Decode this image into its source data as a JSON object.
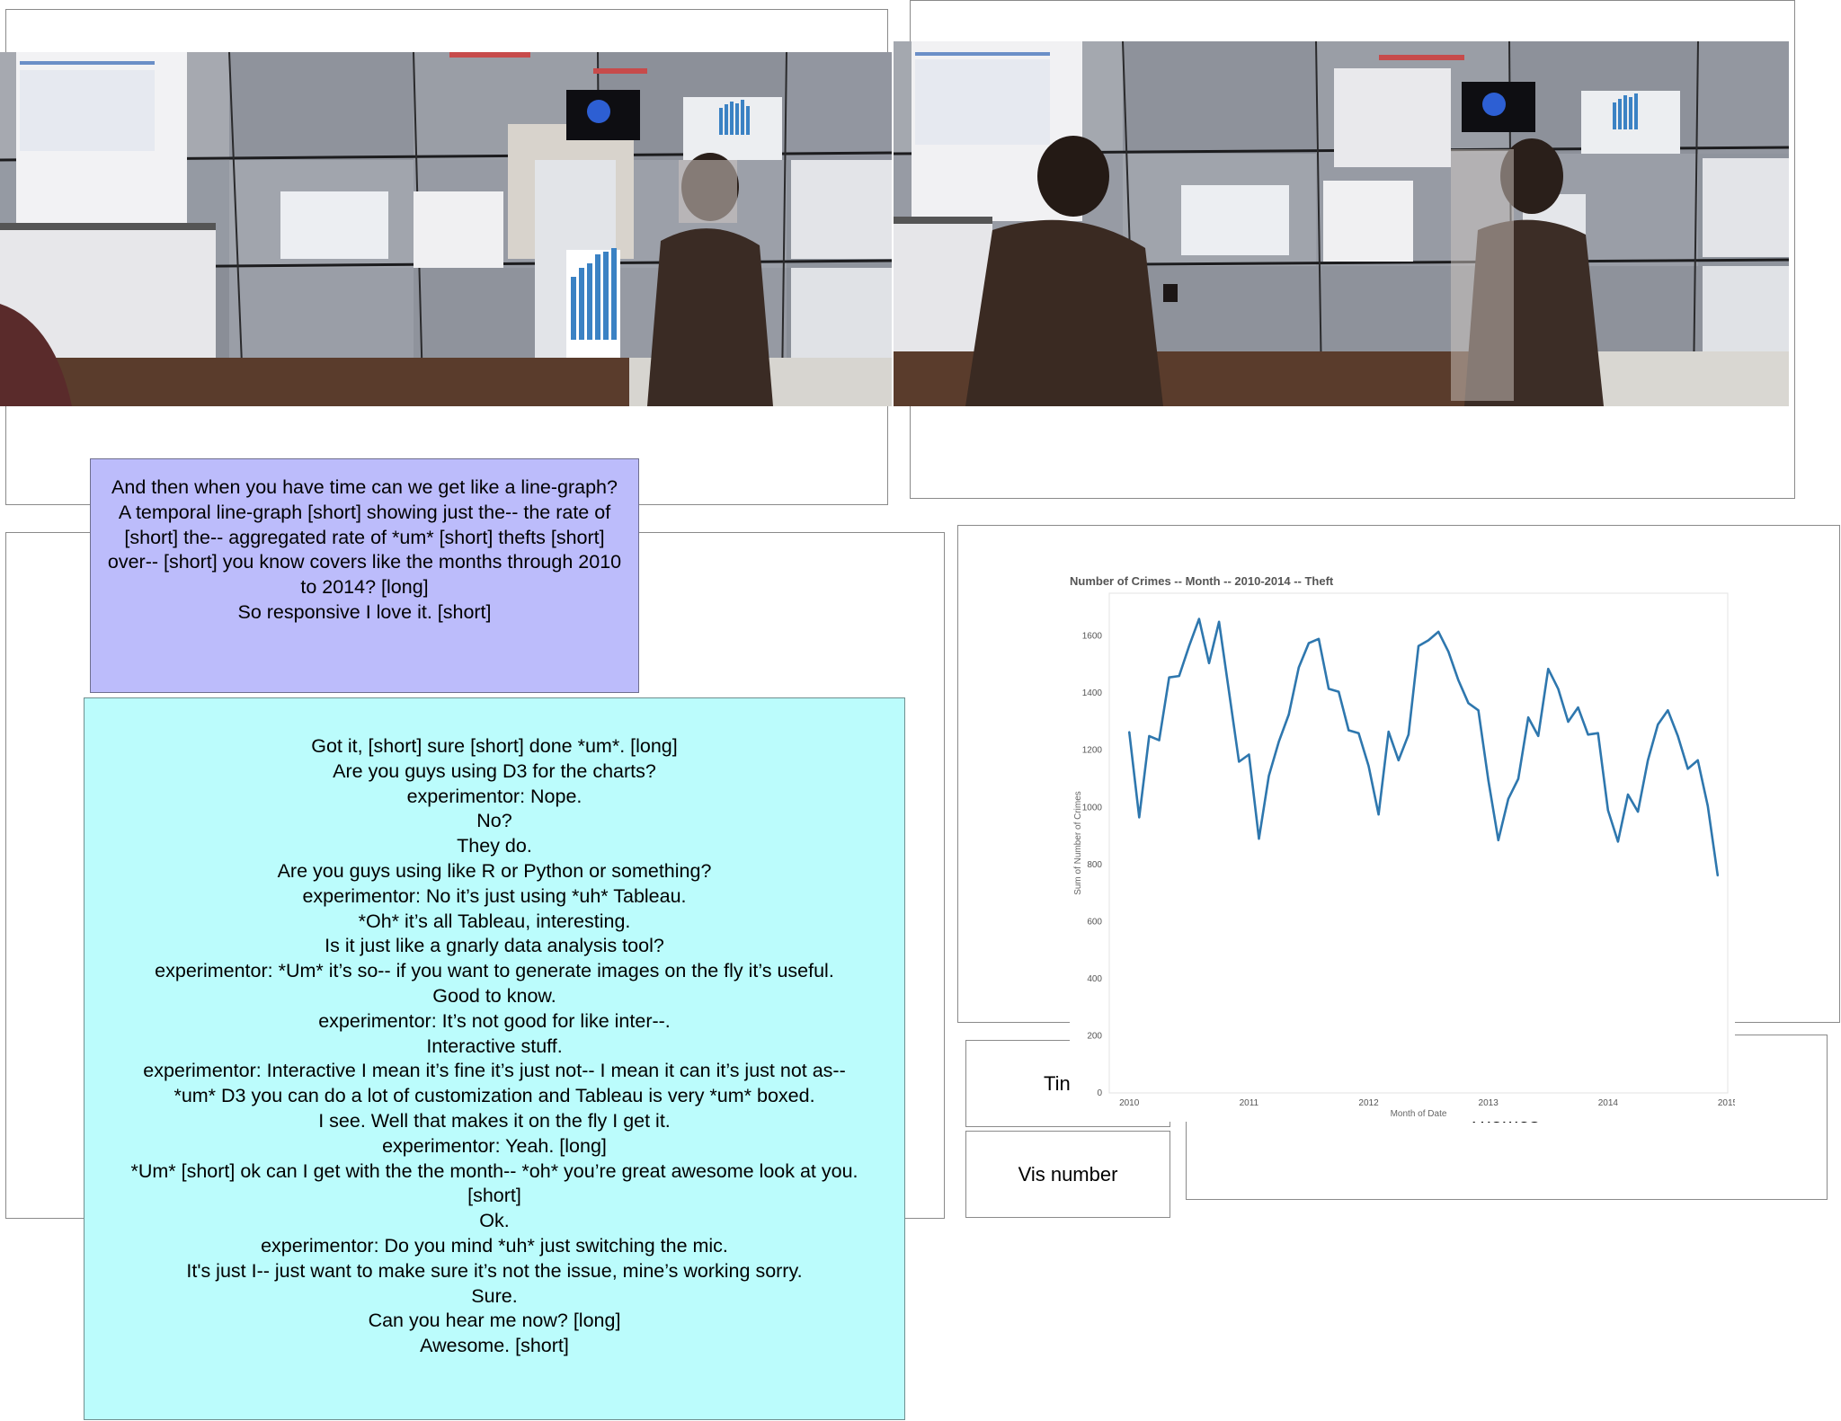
{
  "photos": [
    {
      "name": "display-wall-photo-single-user"
    },
    {
      "name": "display-wall-photo-two-users"
    }
  ],
  "transcripts": {
    "purple": [
      "And then when you have time can we get like a line-graph?",
      "A temporal line-graph [short] showing just the-- the rate of [short] the-- aggregated rate of *um* [short] thefts [short] over-- [short] you know covers like the months through 2010 to 2014? [long]",
      "So responsive I love it. [short]"
    ],
    "cyan": [
      "Got it, [short] sure [short] done *um*. [long]",
      "Are you guys using D3 for the charts?",
      "experimentor: Nope.",
      "No?",
      "They do.",
      "Are you guys using like R or Python or something?",
      "experimentor: No it’s just using *uh* Tableau.",
      "*Oh* it’s all Tableau, interesting.",
      "Is it just like a gnarly data analysis tool?",
      "experimentor: *Um* it’s so-- if you want to generate images on the fly it’s useful.",
      "Good to know.",
      "experimentor: It’s not good for like inter--.",
      "Interactive stuff.",
      "experimentor: Interactive I mean it’s fine it’s just not-- I mean it can it’s just not as--",
      "*um* D3 you can do a lot of customization and Tableau is very *um* boxed.",
      "I see. Well that makes it on the fly I get it.",
      "experimentor: Yeah. [long]",
      "*Um* [short] ok can I get with the the month-- *oh* you’re great awesome look at you.",
      "[short]",
      "Ok.",
      "experimentor: Do you mind *uh* just switching the mic.",
      "It's just I-- just want to make sure it’s not the issue, mine’s working sorry.",
      "Sure.",
      "Can you hear me now? [long]",
      "Awesome. [short]"
    ]
  },
  "labels": {
    "time": "Tin",
    "vis_number": "Vis number",
    "themes": "Themes"
  },
  "chart_data": {
    "type": "line",
    "title": "Number of Crimes -- Month -- 2010-2014 -- Theft",
    "xlabel": "Month of Date",
    "ylabel": "Sum of Number of Crimes",
    "x_ticks": [
      "2010",
      "2011",
      "2012",
      "2013",
      "2014",
      "2015"
    ],
    "y_ticks": [
      "0",
      "200",
      "400",
      "600",
      "800",
      "1000",
      "1200",
      "1400",
      "1600"
    ],
    "ylim": [
      0,
      1750
    ],
    "xlim": [
      "2009-11",
      "2015-01"
    ],
    "grid": false,
    "color": "#2e77ae",
    "series": [
      {
        "x": [
          "2010-01",
          "2010-02",
          "2010-03",
          "2010-04",
          "2010-05",
          "2010-06",
          "2010-07",
          "2010-08",
          "2010-09",
          "2010-10",
          "2010-11",
          "2010-12",
          "2011-01",
          "2011-02",
          "2011-03",
          "2011-04",
          "2011-05",
          "2011-06",
          "2011-07",
          "2011-08",
          "2011-09",
          "2011-10",
          "2011-11",
          "2011-12",
          "2012-01",
          "2012-02",
          "2012-03",
          "2012-04",
          "2012-05",
          "2012-06",
          "2012-07",
          "2012-08",
          "2012-09",
          "2012-10",
          "2012-11",
          "2012-12",
          "2013-01",
          "2013-02",
          "2013-03",
          "2013-04",
          "2013-05",
          "2013-06",
          "2013-07",
          "2013-08",
          "2013-09",
          "2013-10",
          "2013-11",
          "2013-12",
          "2014-01",
          "2014-02",
          "2014-03",
          "2014-04",
          "2014-05",
          "2014-06",
          "2014-07",
          "2014-08",
          "2014-09",
          "2014-10",
          "2014-11",
          "2014-12"
        ],
        "values": [
          1265,
          965,
          1250,
          1235,
          1455,
          1460,
          1565,
          1660,
          1505,
          1650,
          1405,
          1160,
          1185,
          890,
          1110,
          1230,
          1325,
          1490,
          1575,
          1590,
          1415,
          1405,
          1270,
          1260,
          1145,
          975,
          1265,
          1165,
          1255,
          1565,
          1585,
          1615,
          1545,
          1445,
          1365,
          1340,
          1095,
          885,
          1030,
          1100,
          1315,
          1250,
          1485,
          1415,
          1300,
          1350,
          1255,
          1260,
          990,
          880,
          1045,
          985,
          1165,
          1290,
          1340,
          1250,
          1135,
          1165,
          1005,
          760
        ]
      }
    ]
  }
}
